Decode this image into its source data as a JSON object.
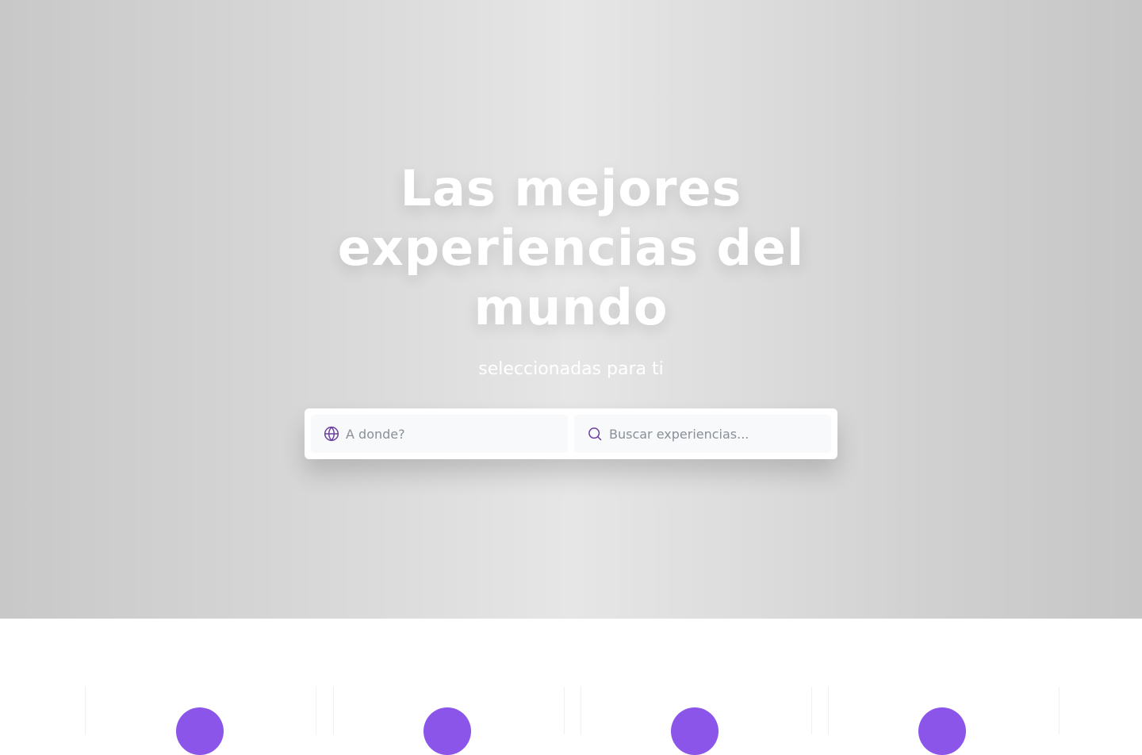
{
  "hero": {
    "title": "Las mejores experiencias del mundo",
    "subtitle": "seleccionadas para ti"
  },
  "search": {
    "destination_placeholder": "A donde?",
    "experience_placeholder": "Buscar experiencias...",
    "destination_icon": "globe-icon",
    "experience_icon": "search-icon"
  },
  "colors": {
    "accent": "#8b55ea",
    "icon": "#6b3f9e"
  },
  "features": {
    "count": 4
  }
}
